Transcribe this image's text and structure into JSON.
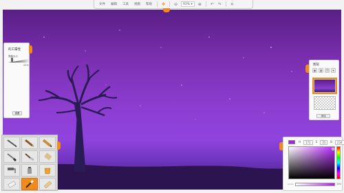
{
  "toolbar": {
    "menu": [
      "文件",
      "编辑",
      "工具",
      "视图",
      "帮助"
    ],
    "zoom": "93%"
  },
  "brush_panel": {
    "title": "的工属性",
    "size_label": "笔触大小",
    "opacity_pct": "22%",
    "confirm_label": "重置"
  },
  "layers_panel": {
    "title": "图层",
    "add_label": "添加"
  },
  "color_panel": {
    "current_color": "#ac1fea",
    "h_label": "H",
    "h_value": "172",
    "s_label": "S",
    "s_value": "23",
    "b_label": "B",
    "b_value": "234",
    "alpha_label": "Alpha",
    "alpha_value": "100"
  },
  "tools": [
    "pencil",
    "marker",
    "crayon",
    "brush",
    "knife",
    "paint-tube",
    "fill",
    "spray",
    "bucket",
    "eraser",
    "brush-orange",
    "paper-roll"
  ],
  "colors": {
    "accent": "#f08a1c",
    "sky_top": "#5a1f86",
    "sky_mid": "#8d3ed1",
    "ground": "#2c1450"
  }
}
